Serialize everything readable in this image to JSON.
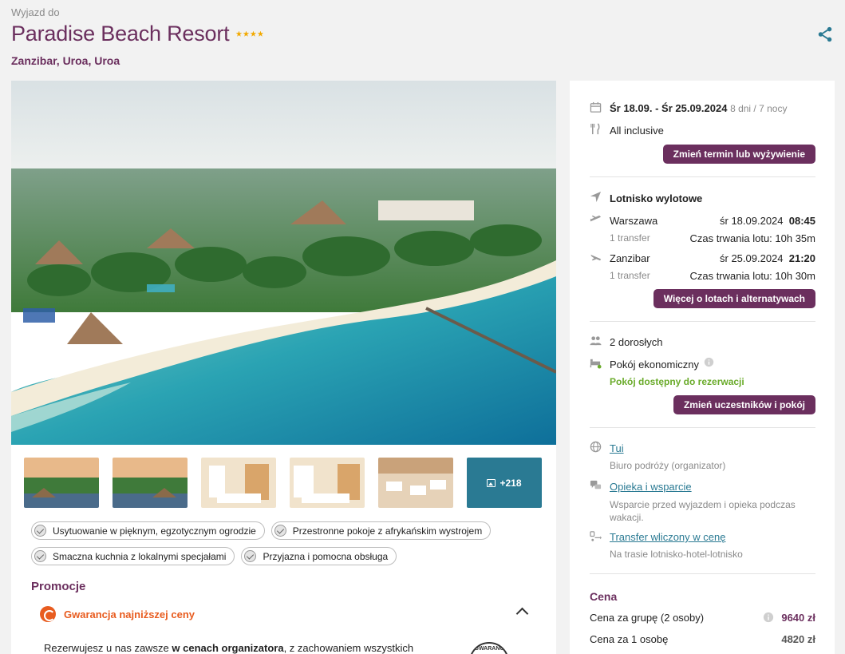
{
  "header": {
    "eyebrow": "Wyjazd do",
    "title": "Paradise Beach Resort",
    "stars": 4,
    "location": "Zanzibar, Uroa, Uroa"
  },
  "gallery": {
    "more_label": "+218"
  },
  "features": [
    "Usytuowanie w pięknym, egzotycznym ogrodzie",
    "Przestronne pokoje z afrykańskim wystrojem",
    "Smaczna kuchnia z lokalnymi specjałami",
    "Przyjazna i pomocna obsługa"
  ],
  "promo": {
    "section_title": "Promocje",
    "label": "Gwarancja najniższej ceny",
    "text_part1": "Rezerwujesz u nas zawsze ",
    "text_bold": "w cenach organizatora",
    "text_part2": ", z zachowaniem wszystkich",
    "seal_text": "GWARANC"
  },
  "booking": {
    "dates": "Śr 18.09. - Śr 25.09.2024",
    "duration": "8 dni / 7 nocy",
    "board": "All inclusive",
    "change_term_btn": "Zmień termin lub wyżywienie",
    "airport_title": "Lotnisko wylotowe",
    "outbound": {
      "city": "Warszawa",
      "date": "śr 18.09.2024",
      "time": "08:45",
      "transfers": "1 transfer",
      "duration": "Czas trwania lotu: 10h 35m"
    },
    "inbound": {
      "city": "Zanzibar",
      "date": "śr 25.09.2024",
      "time": "21:20",
      "transfers": "1 transfer",
      "duration": "Czas trwania lotu: 10h 30m"
    },
    "flights_btn": "Więcej o lotach i alternatywach",
    "guests": "2 dorosłych",
    "room": "Pokój ekonomiczny",
    "room_status": "Pokój dostępny do rezerwacji",
    "change_guests_btn": "Zmień uczestników i pokój",
    "operator_link": "Tui",
    "operator_desc": "Biuro podróży (organizator)",
    "care_link": "Opieka i wsparcie",
    "care_desc": "Wsparcie przed wyjazdem i opieka podczas wakacji.",
    "transfer_link": "Transfer wliczony w cenę",
    "transfer_desc": "Na trasie lotnisko-hotel-lotnisko",
    "price_title": "Cena",
    "group_price_label": "Cena za grupę (2 osoby)",
    "group_price": "9640 zł",
    "person_price_label": "Cena za 1 osobę",
    "person_price": "4820 zł"
  },
  "colors": {
    "brand": "#6b2f5e",
    "accent_orange": "#e85c1f",
    "link": "#2a7a93",
    "green": "#6aab2a"
  }
}
